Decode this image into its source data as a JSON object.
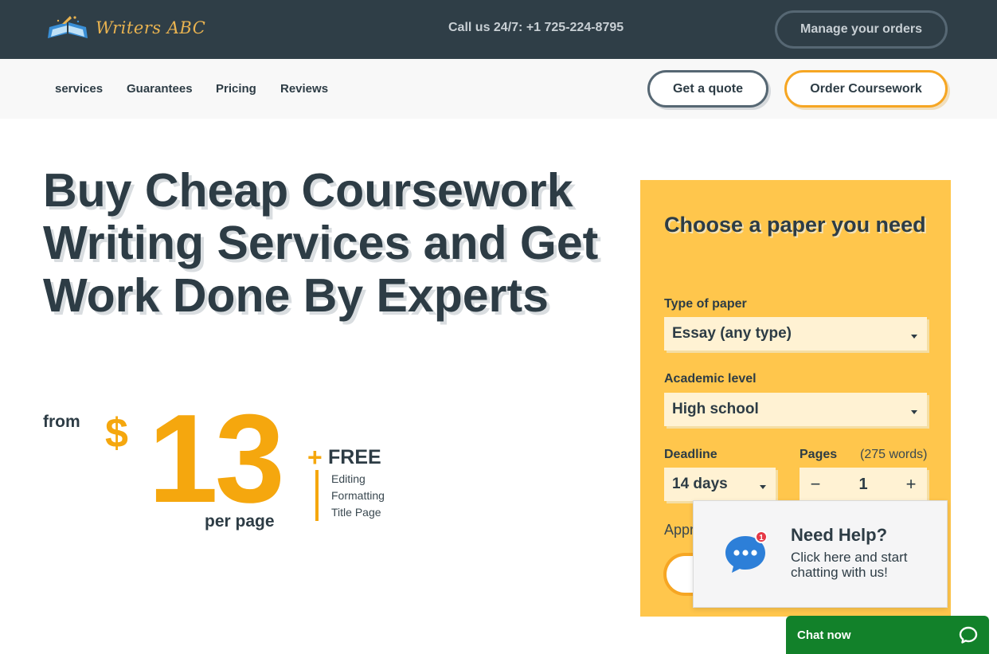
{
  "header": {
    "logo_text": "Writers ABC",
    "phone": "Call us 24/7: +1 725-224-8795",
    "manage_orders": "Manage your orders"
  },
  "nav": {
    "items": [
      "services",
      "Guarantees",
      "Pricing",
      "Reviews"
    ],
    "get_quote": "Get a quote",
    "order_coursework": "Order Coursework"
  },
  "hero": {
    "title": "Buy Cheap Coursework Writing Services and Get Work Done By Experts",
    "from": "from",
    "currency": "$",
    "price": "13",
    "per_page": "per page",
    "plus": "+",
    "free": "FREE",
    "free_items": [
      "Editing",
      "Formatting",
      "Title Page"
    ]
  },
  "order_form": {
    "title": "Choose a paper you need",
    "type_label": "Type of paper",
    "type_value": "Essay (any type)",
    "level_label": "Academic level",
    "level_value": "High school",
    "deadline_label": "Deadline",
    "deadline_value": "14 days",
    "pages_label": "Pages",
    "words": "(275 words)",
    "pages_value": "1",
    "minus": "−",
    "plus": "+",
    "approx_partial": "Appr"
  },
  "chat": {
    "badge": "1",
    "help_title": "Need Help?",
    "help_text_line1": "Click here and start",
    "help_text_line2": "chatting with us!",
    "chat_now": "Chat now"
  },
  "colors": {
    "topbar": "#2f3e47",
    "accent": "#f5a70e",
    "card": "#ffc64c",
    "chat_green": "#12812a"
  }
}
